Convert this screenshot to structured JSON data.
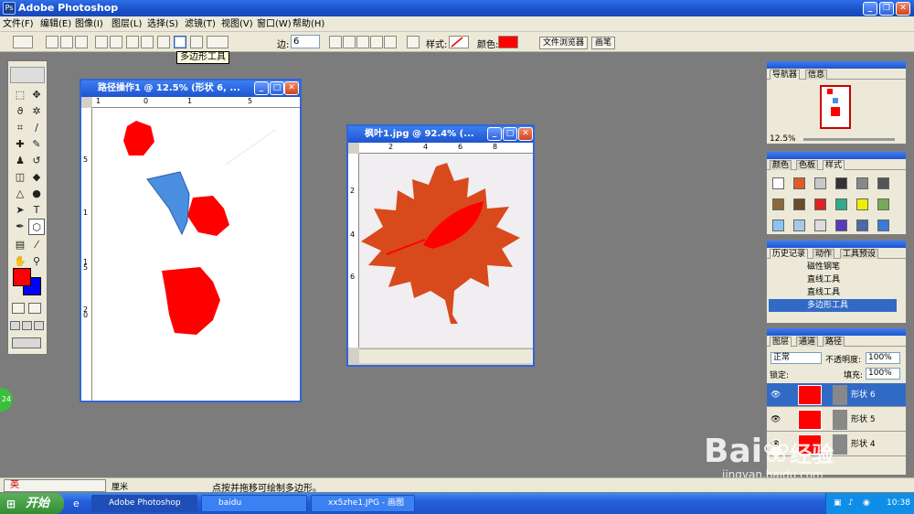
{
  "app": {
    "title": "Adobe Photoshop",
    "icon": "photoshop-icon"
  },
  "menu": [
    "文件(F)",
    "编辑(E)",
    "图像(I)",
    "图层(L)",
    "选择(S)",
    "滤镜(T)",
    "视图(V)",
    "窗口(W)",
    "帮助(H)"
  ],
  "options": {
    "sides_label": "边:",
    "sides_value": "6",
    "style_label": "样式:",
    "color_label": "颜色:",
    "color_value": "#ff0000",
    "tab_file_browser": "文件浏览器",
    "tab_brushes": "画笔"
  },
  "tooltip": "多边形工具",
  "doc1": {
    "title": "路径操作1 @ 12.5% (形状 6, ...",
    "ruler_h": [
      "1",
      "0",
      "1",
      "5"
    ],
    "ruler_v": [
      "5",
      "1",
      "1",
      "5",
      "2",
      "0"
    ]
  },
  "doc2": {
    "title": "枫叶1.jpg @ 92.4% (...",
    "ruler_h": [
      "2",
      "4",
      "6",
      "8"
    ],
    "ruler_v": [
      "2",
      "4",
      "6"
    ]
  },
  "navigator": {
    "tabs": [
      "导航器",
      "信息"
    ],
    "zoom": "12.5%"
  },
  "swatches": {
    "tabs": [
      "颜色",
      "色板",
      "样式"
    ]
  },
  "history": {
    "tabs": [
      "历史记录",
      "动作",
      "工具预设"
    ],
    "items": [
      "磁性钢笔",
      "直线工具",
      "直线工具",
      "多边形工具"
    ]
  },
  "layers": {
    "tabs": [
      "图层",
      "通道",
      "路径"
    ],
    "blend_mode": "正常",
    "opacity_label": "不透明度:",
    "opacity_value": "100%",
    "lock_label": "锁定:",
    "fill_label": "填充:",
    "fill_value": "100%",
    "items": [
      "形状 6",
      "形状 5",
      "形状 4"
    ]
  },
  "status": {
    "unit": "厘米",
    "message": "点按并拖移可绘制多边形。",
    "ime": "英"
  },
  "taskbar": {
    "start": "开始",
    "items": [
      "Adobe Photoshop",
      "baidu",
      "xx5zhe1.JPG - 画图"
    ],
    "time": "10:38"
  },
  "watermark": {
    "brand": "Bai",
    "brand2": "经验",
    "url": "jingyan.baidu.com"
  },
  "colors": {
    "foreground": "#ff0000",
    "background": "#0000ff",
    "leaf": "#d84a1c"
  }
}
